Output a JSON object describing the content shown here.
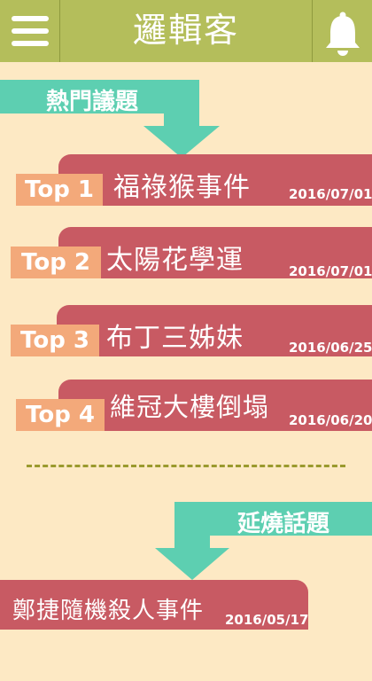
{
  "header": {
    "title": "邏輯客",
    "menu_icon": "hamburger-menu-icon",
    "bell_icon": "bell-icon"
  },
  "hot_topics": {
    "label": "熱門議題",
    "items": [
      {
        "rank": "Top 1",
        "title": "福祿猴事件",
        "date": "2016/07/01"
      },
      {
        "rank": "Top 2",
        "title": "太陽花學運",
        "date": "2016/07/01"
      },
      {
        "rank": "Top 3",
        "title": "布丁三姊妹",
        "date": "2016/06/25"
      },
      {
        "rank": "Top 4",
        "title": "維冠大樓倒塌",
        "date": "2016/06/20"
      }
    ]
  },
  "ongoing_topics": {
    "label": "延燒話題",
    "items": [
      {
        "title": "鄭捷隨機殺人事件",
        "date": "2016/05/17"
      }
    ]
  },
  "colors": {
    "header_bg": "#b4be5b",
    "page_bg": "#fde9c4",
    "teal_arrow": "#5dcfb1",
    "banner": "#c85a63",
    "rank_badge": "#f3a97a"
  }
}
